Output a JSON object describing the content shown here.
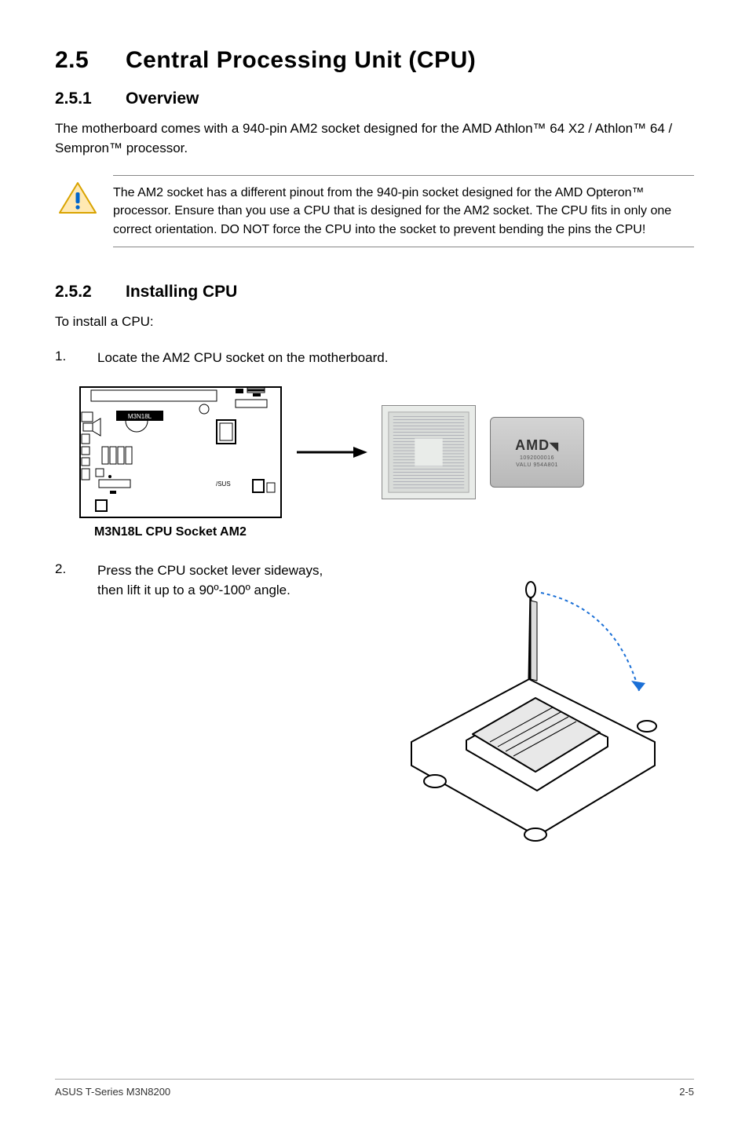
{
  "heading": {
    "number": "2.5",
    "title": "Central Processing Unit (CPU)"
  },
  "sections": {
    "overview": {
      "number": "2.5.1",
      "title": "Overview",
      "paragraph": "The motherboard comes with a 940-pin AM2 socket designed for the AMD Athlon™ 64 X2 / Athlon™ 64 / Sempron™ processor."
    },
    "callout": {
      "text": "The AM2 socket has a different pinout from the 940-pin socket designed for the AMD Opteron™ processor. Ensure than you use a CPU that is designed for the AM2 socket. The CPU fits in only one correct orientation. DO NOT force the CPU into the socket to prevent bending the pins the CPU!"
    },
    "installing": {
      "number": "2.5.2",
      "title": "Installing CPU",
      "intro": "To install a CPU:",
      "steps": {
        "1": {
          "num": "1.",
          "text": "Locate the AM2 CPU socket on the motherboard."
        },
        "2": {
          "num": "2.",
          "text": "Press the CPU socket lever sideways, then lift it up to a 90º-100º angle."
        }
      },
      "boardLabel": "M3N18L",
      "diagramLabel": "M3N18L CPU Socket AM2",
      "amdBrand": "AMD",
      "amdSub1": "1092000016",
      "amdSub2": "VALU 954A801"
    }
  },
  "footer": {
    "left": "ASUS T-Series M3N8200",
    "right": "2-5"
  }
}
